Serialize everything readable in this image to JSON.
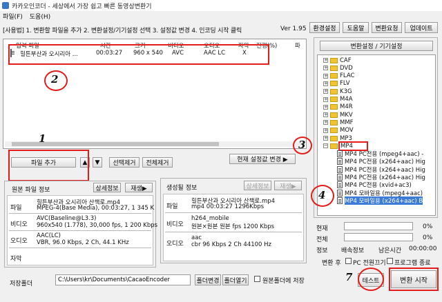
{
  "window": {
    "title": "카카오인코더 - 세상에서 가장 쉽고 빠른 동영상변환기"
  },
  "menu": {
    "file": "파일(F)",
    "help": "도움(H)"
  },
  "instructions": "[사용법] 1. 변환할 파일을 추가  2. 변환설정/기기설정 선택  3. 설정값 변경  4. 인코딩 시작 클릭",
  "version": "Ver 1.95",
  "top_buttons": {
    "env": "환경설정",
    "help": "도움말",
    "request": "변환요청",
    "update": "업데이트"
  },
  "file_list": {
    "columns": [
      "입력 파일",
      "시간",
      "크기",
      "비디오",
      "오디오",
      "자막",
      "진행(%)",
      "파"
    ],
    "rows": [
      {
        "name": "힐튼부산과 오시리아 ...",
        "time": "00:03:27",
        "size": "960 x 540",
        "video": "AVC",
        "audio": "AAC LC",
        "subtitle": "X",
        "progress": ""
      }
    ]
  },
  "list_buttons": {
    "add_file": "파일 추가",
    "up": "▲",
    "down": "▼",
    "remove_selected": "선택제거",
    "remove_all": "전체제거",
    "apply_settings": "현재 설정값 변경 ▶"
  },
  "source_info": {
    "title": "원본 파일 정보",
    "detail_button": "상세정보",
    "play_button": "재생▶",
    "file_label": "파일",
    "file_line1": "힐튼부산과 오시리아 산책로.mp4",
    "file_line2": "MPEG-4(Base Media), 00:03:27, 1 345 K",
    "video_label": "비디오",
    "video_line1": "AVC(Baseline@L3.3)",
    "video_line2": "960x540 (1.778), 30,000 fps, 1 200 Kbps",
    "audio_label": "오디오",
    "audio_line1": "AAC(LC)",
    "audio_line2": "VBR, 96.0 Kbps, 2 Ch, 44.1 KHz",
    "subtitle_label": "자막"
  },
  "output_info": {
    "title": "생성될 정보",
    "detail_button": "상세정보",
    "play_button": "재생▶",
    "file_label": "파일",
    "file_line1": "힐튼부산과 오시리아 산책로.mp4",
    "file_line2": "mp4   00:03:27   1296Kbps",
    "video_label": "비디오",
    "video_line1": "h264_mobile",
    "video_line2": "원본×원본   원본 fps    1200 Kbps",
    "audio_label": "오디오",
    "audio_line1": "aac",
    "audio_line2": "cbr     96 Kbps   2 Ch    44100 Hz"
  },
  "save_folder": {
    "label": "저장폴더",
    "path": "C:\\Users\\kr\\Documents\\CacaoEncoder",
    "change_button": "폴더변경",
    "open_button": "폴더열기",
    "same_as_source": "원본폴더에 저장"
  },
  "settings_tree": {
    "title": "변환설정 / 기기설정",
    "folders": [
      "CAF",
      "DVD",
      "FLAC",
      "FLV",
      "K3G",
      "M4A",
      "M4R",
      "MKV",
      "MMF",
      "MOV",
      "MP3",
      "MP4"
    ],
    "selected_folder": "MP4",
    "presets": [
      "MP4 PC전용 (mpeg4+aac) -",
      "MP4 PC전용 (x264+aac) Hig",
      "MP4 PC전용 (x264+aac) Hig",
      "MP4 PC전용 (x264+aac) Hig",
      "MP4 PC전용 (xvid+ac3)",
      "MP4 모바일용 (mpeg4+aac)",
      "MP4 모바일용 (x264+aac) B"
    ],
    "selected_preset_index": 6
  },
  "progress": {
    "current_label": "현재",
    "current_value": "0%",
    "current_fraction": 0,
    "total_label": "전체",
    "total_value": "0%",
    "total_fraction": 0,
    "info_label": "정보",
    "speed_label": "배속정보",
    "remaining_label": "남은시간",
    "remaining_value": "00:00:00"
  },
  "after_convert": {
    "label": "변환 후",
    "pc_off": "PC 전원끄기",
    "program_exit": "프로그램 종료"
  },
  "bottom_buttons": {
    "test": "테스트",
    "start": "변환 시작"
  },
  "annotations": {
    "n1": "1",
    "n2": "2",
    "n3": "3",
    "n4": "4",
    "n7": "7"
  },
  "colors": {
    "annotation_red": "#e31b1b",
    "selection_blue": "#3d7bd9",
    "folder_yellow": "#f1c232"
  }
}
